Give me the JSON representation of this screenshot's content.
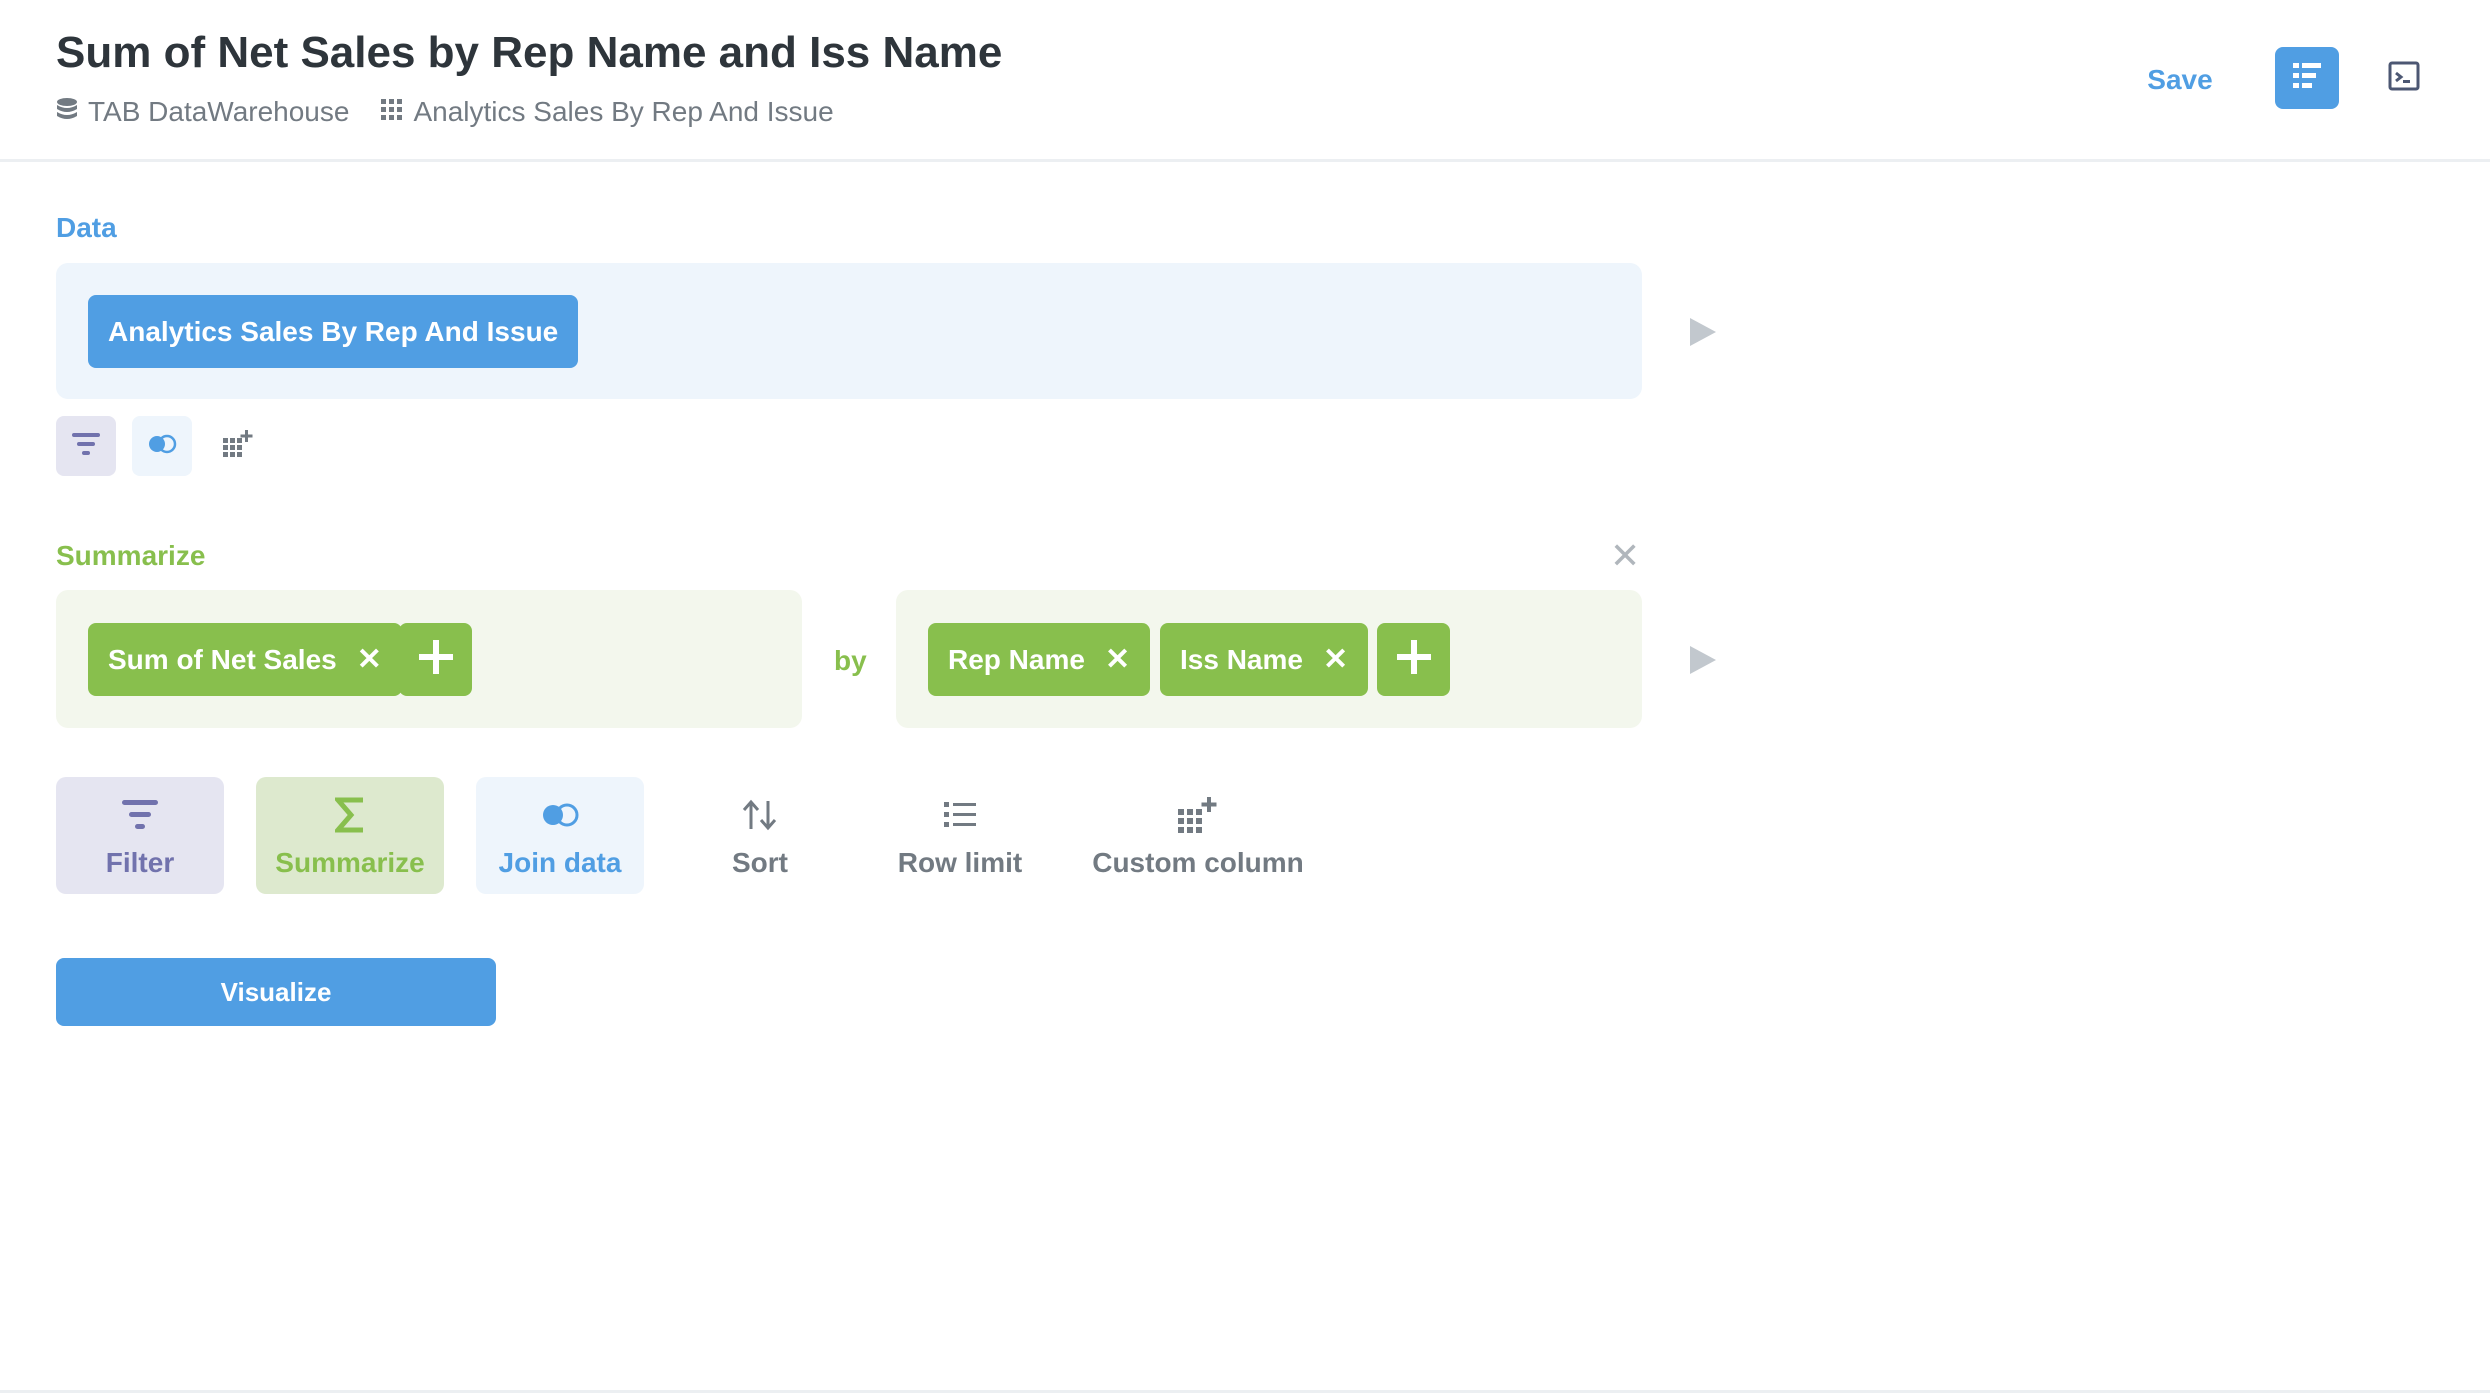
{
  "header": {
    "title": "Sum of Net Sales by Rep Name and Iss Name",
    "database": "TAB DataWarehouse",
    "table": "Analytics Sales By Rep And Issue",
    "save_label": "Save"
  },
  "data_step": {
    "label": "Data",
    "source_table": "Analytics Sales By Rep And Issue"
  },
  "summarize_step": {
    "label": "Summarize",
    "metrics": [
      {
        "label": "Sum of Net Sales"
      }
    ],
    "by_label": "by",
    "breakouts": [
      {
        "label": "Rep Name"
      },
      {
        "label": "Iss Name"
      }
    ]
  },
  "actions": [
    {
      "label": "Filter",
      "icon": "filter-icon"
    },
    {
      "label": "Summarize",
      "icon": "sigma-icon"
    },
    {
      "label": "Join data",
      "icon": "join-icon"
    },
    {
      "label": "Sort",
      "icon": "sort-icon"
    },
    {
      "label": "Row limit",
      "icon": "list-icon"
    },
    {
      "label": "Custom column",
      "icon": "add-column-icon"
    }
  ],
  "visualize_label": "Visualize",
  "colors": {
    "brand": "#509ee3",
    "summarize": "#88bf4d",
    "filter": "#7172ad",
    "filter_bg": "#e5e5f1",
    "summarize_bg": "#dde9ce",
    "join_bg": "#eef5fc",
    "text_dark": "#2e353b",
    "text_light": "#727a82"
  }
}
